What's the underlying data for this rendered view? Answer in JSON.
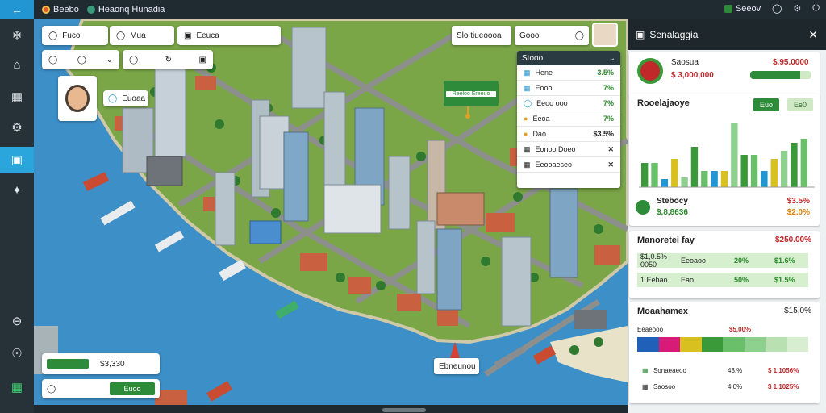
{
  "topbar": {
    "title": "Heaonq Hunadia",
    "label_left": "Beebo",
    "right_label": "Seeov"
  },
  "map_controls": {
    "row1": [
      {
        "icon": "wallet-icon",
        "label": "Fuco"
      },
      {
        "icon": "drop-icon",
        "label": "Mua"
      },
      {
        "icon": "image-icon",
        "label": "Eeuca"
      }
    ],
    "row2_icons": [
      "clock-icon",
      "speed-icon",
      "dropdown-icon",
      "clock-icon",
      "refresh-icon",
      "camera-icon"
    ],
    "badge": "Euoaa",
    "search_label": "Slo tiueoooa",
    "search2_label": "Gooo"
  },
  "tooltip": {
    "label": "Reeloo Ereeuo"
  },
  "callout": {
    "label": "Ebneunou"
  },
  "dropdown": {
    "header": "Stooo",
    "rows": [
      {
        "icon": "building-icon",
        "label": "Hene",
        "value": "3.5%"
      },
      {
        "icon": "doc-icon",
        "label": "Eooo",
        "value": "7%"
      },
      {
        "icon": "info-icon",
        "label": "Eeoo ooo",
        "value": "7%"
      },
      {
        "icon": "gauge-icon",
        "label": "Eeoa",
        "value": "7%"
      },
      {
        "icon": "tag-icon",
        "label": "Dao",
        "value": "$3.5%"
      },
      {
        "icon": "grid-icon",
        "label": "Eonoo Doeo",
        "value": "✕"
      },
      {
        "icon": "grid-icon",
        "label": "Eeooaeseo",
        "value": "✕"
      }
    ]
  },
  "bottom_left": {
    "value1": "$3,330",
    "button2": "Euoo"
  },
  "right_panel": {
    "title": "Senalaggia",
    "profile": {
      "name": "Saosua",
      "amount": "$ 3,000,000",
      "right_value": "$.95.0000",
      "progress": 0.82
    },
    "stats_title": "Rooelajaoye",
    "btn1": "Euo",
    "btn2": "Ee0",
    "bar_chart": {
      "series_a": [
        30,
        30,
        10,
        35,
        12,
        50,
        20,
        20,
        20,
        80,
        40,
        40,
        20,
        35,
        45,
        55,
        60
      ],
      "series_b": [
        0,
        0,
        0,
        0,
        0,
        0,
        0,
        0,
        0,
        0,
        0,
        0,
        0,
        0,
        0,
        0,
        0
      ]
    },
    "status_row": {
      "name": "Stebocy",
      "sub": "$,8,8636",
      "value": "$3.5%",
      "value2": "$2.0%"
    },
    "market_title": "Manoretei fay",
    "market_value": "$250.00%",
    "market_rows": [
      {
        "label": "$1,0.5% 0050",
        "mid": "Eeoaoo",
        "v1": "20%",
        "v2": "$1.6%"
      },
      {
        "label": "1 Eebao",
        "mid": "Eao",
        "v1": "50%",
        "v2": "$1.5%"
      }
    ],
    "bottom_title": "Moaahamex",
    "bottom_value": "$15,0%",
    "bottom_sub1": "Eeaeooo",
    "bottom_sub2": "$5,00%",
    "colors": [
      "#2060b8",
      "#d81b78",
      "#d8c020",
      "#3a9a3a",
      "#6ac06a",
      "#8ed08e",
      "#b8e0b0",
      "#d8eed0"
    ],
    "list": [
      {
        "label": "Sonaeaeoo",
        "v1": "43,%",
        "v2": "$ 1,1056%"
      },
      {
        "label": "Saosoo",
        "v1": "4.0%",
        "v2": "$ 1,1025%"
      }
    ]
  },
  "colors": {
    "accent": "#2196d3",
    "green": "#2e8b3a",
    "red": "#c0282a",
    "water": "#3d8fc7",
    "grass": "#7aa648"
  }
}
